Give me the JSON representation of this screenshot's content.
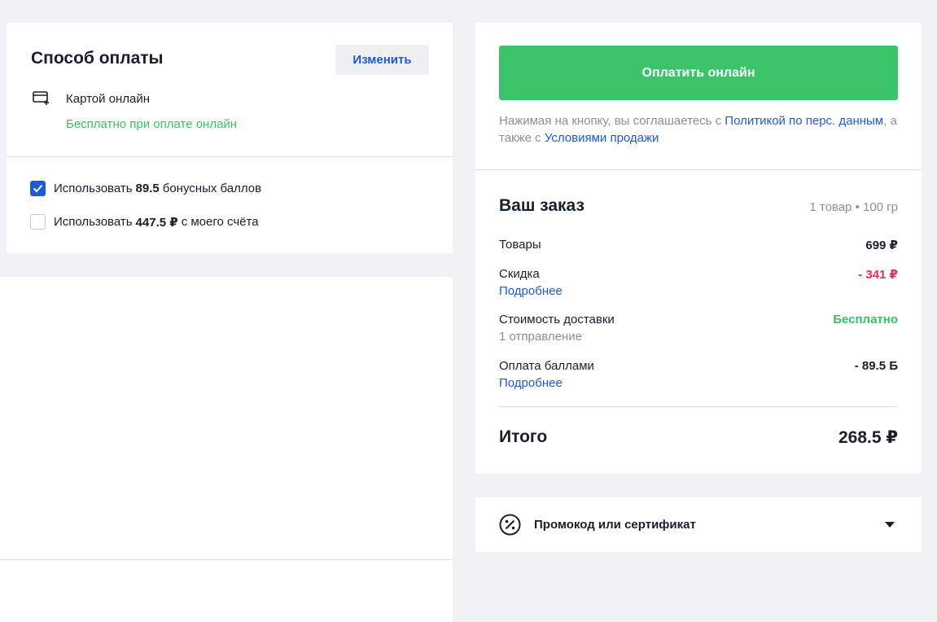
{
  "payment": {
    "title": "Способ оплаты",
    "change_label": "Изменить",
    "method_icon": "card-plus-icon",
    "method_label": "Картой онлайн",
    "free_note": "Бесплатно при оплате онлайн"
  },
  "bonus_options": [
    {
      "prefix": "Использовать",
      "amount": "89.5",
      "suffix": "бонусных баллов",
      "checked": true
    },
    {
      "prefix": "Использовать",
      "amount": "447.5 ₽",
      "suffix": "с моего счёта",
      "checked": false
    }
  ],
  "checkout": {
    "pay_button": "Оплатить онлайн",
    "agree_text_1": "Нажимая на кнопку, вы соглашаетесь с",
    "policy_link": "Политикой по перс. данным",
    "agree_text_2": ", а также с",
    "terms_link": "Условиями продажи"
  },
  "order": {
    "title": "Ваш заказ",
    "meta": "1 товар • 100 гр",
    "lines": {
      "goods": {
        "label": "Товары",
        "value": "699 ₽"
      },
      "discount": {
        "label": "Скидка",
        "link": "Подробнее",
        "value": "- 341 ₽"
      },
      "delivery": {
        "label": "Стоимость доставки",
        "sub": "1 отправление",
        "value": "Бесплатно"
      },
      "points": {
        "label": "Оплата баллами",
        "link": "Подробнее",
        "value": "- 89.5 Б"
      }
    },
    "total_label": "Итого",
    "total_value": "268.5 ₽"
  },
  "promo": {
    "icon": "discount-badge-icon",
    "label": "Промокод или сертификат",
    "toggle_icon": "triangle-down-icon"
  },
  "colors": {
    "accent_blue": "#1d5ad6",
    "pay_green": "#3bc46a",
    "discount_red": "#f0285a",
    "free_green": "#3bbf64",
    "background": "#f0f2f5"
  }
}
